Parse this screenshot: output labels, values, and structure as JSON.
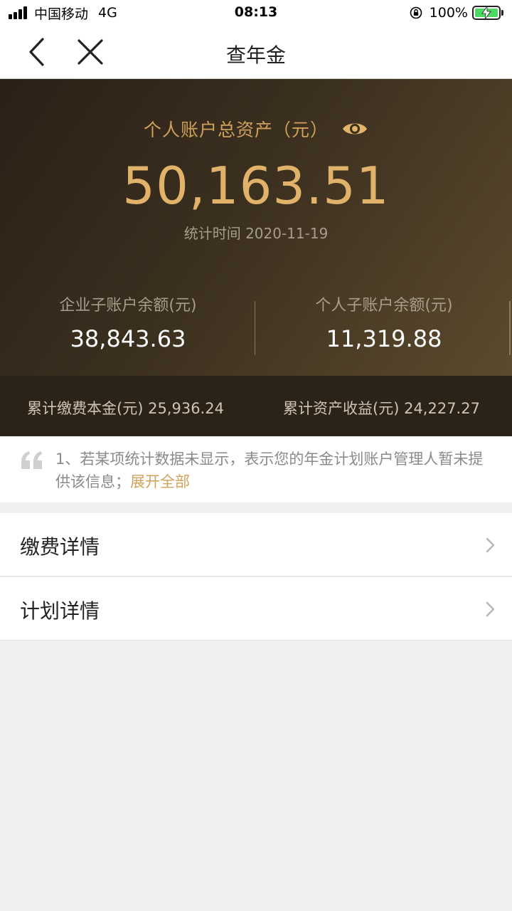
{
  "status_bar": {
    "carrier": "中国移动",
    "network": "4G",
    "time": "08:13",
    "battery_percent": "100%",
    "battery_level": 1.0,
    "icons": [
      "signal-icon",
      "rotation-lock-icon",
      "battery-icon",
      "charging-bolt-icon"
    ]
  },
  "nav": {
    "title": "查年金",
    "icons": [
      "back-arrow-icon",
      "close-icon"
    ]
  },
  "summary": {
    "total_label": "个人账户总资产（元）",
    "total_value": "50,163.51",
    "date_label": "统计时间",
    "date_value": "2020-11-19",
    "enterprise_label": "企业子账户余额(元)",
    "enterprise_value": "38,843.63",
    "personal_label": "个人子账户余额(元)",
    "personal_value": "11,319.88",
    "icons": [
      "eye-icon"
    ]
  },
  "accumulated": {
    "principal_label": "累计缴费本金(元)",
    "principal_value": "25,936.24",
    "income_label": "累计资产收益(元)",
    "income_value": "24,227.27"
  },
  "notice": {
    "text": "1、若某项统计数据未显示，表示您的年金计划账户管理人暂未提供该信息；",
    "expand_label": "展开全部",
    "icons": [
      "quote-icon"
    ]
  },
  "menu": [
    {
      "label": "缴费详情"
    },
    {
      "label": "计划详情"
    }
  ],
  "colors": {
    "gold": "#e0b26a",
    "accent_link": "#d2a15a",
    "hero_dark": "#2a2016",
    "battery_green": "#4cd964"
  }
}
